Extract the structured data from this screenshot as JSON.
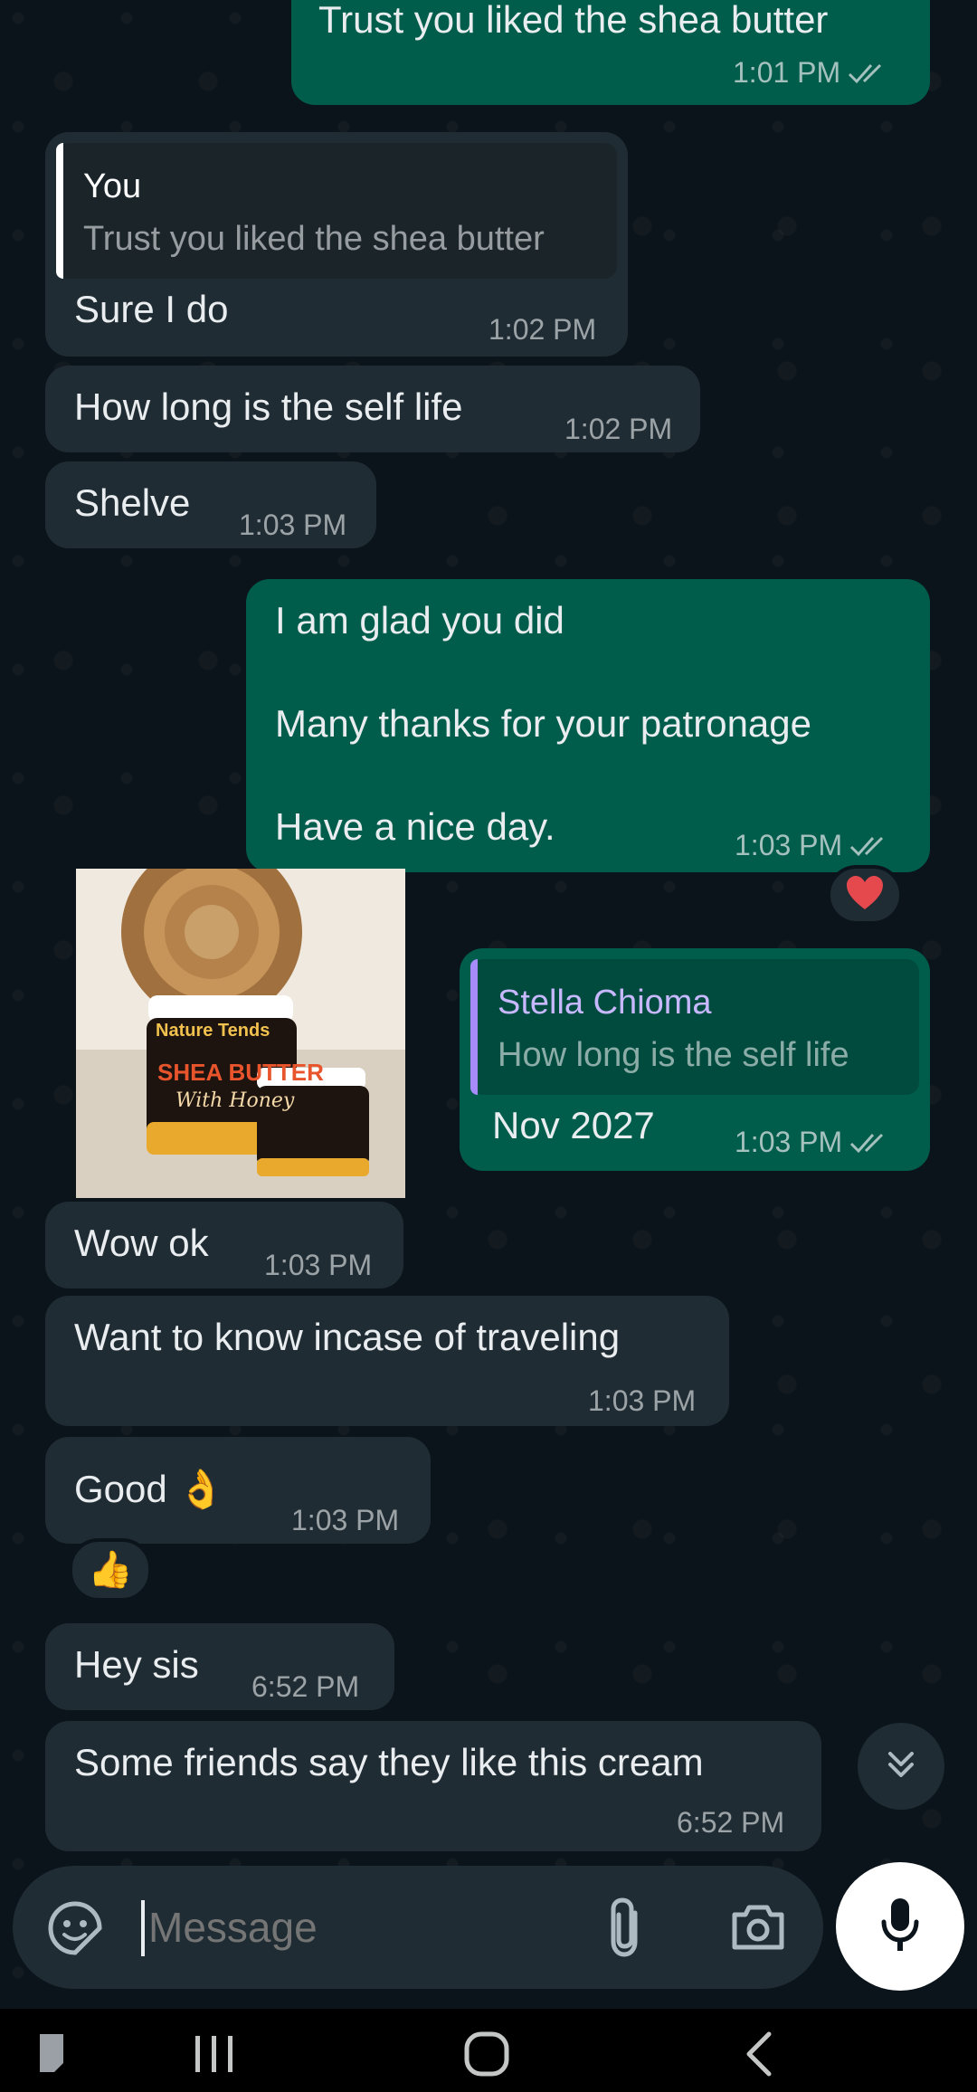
{
  "chat": {
    "messages": [
      {
        "text": "Trust you liked the shea butter",
        "time": "1:01 PM"
      },
      {
        "quote_name": "You",
        "quote_text": "Trust you liked the shea butter",
        "text": "Sure I do",
        "time": "1:02 PM"
      },
      {
        "text": "How long is the self life",
        "time": "1:02 PM"
      },
      {
        "text": "Shelve",
        "time": "1:03 PM"
      },
      {
        "line1": "I am glad you did",
        "line2": "Many thanks for your patronage",
        "line3": "Have a nice day.",
        "time": "1:03 PM",
        "reaction": "❤️"
      },
      {
        "product_label": "Nature Tends",
        "product_title": "SHEA BUTTER",
        "product_subtitle": "With Honey"
      },
      {
        "quote_name": "Stella Chioma",
        "quote_text": "How long is the self life",
        "text": "Nov 2027",
        "time": "1:03 PM"
      },
      {
        "text": "Wow ok",
        "time": "1:03 PM"
      },
      {
        "text": "Want to know incase of traveling",
        "time": "1:03 PM"
      },
      {
        "text": "Good 👌",
        "time": "1:03 PM"
      },
      {
        "emoji": "👍"
      },
      {
        "text": "Hey sis",
        "time": "6:52 PM"
      },
      {
        "text": "Some friends say they like this cream",
        "time": "6:52 PM"
      }
    ]
  },
  "composer": {
    "placeholder": "Message"
  },
  "colors": {
    "background": "#0b141a",
    "incoming_bubble": "#202c33",
    "outgoing_bubble": "#005c4b",
    "quote_you": "#ffffff",
    "quote_stella": "#a78bfa",
    "read_ticks": "#8ab4c7"
  },
  "icons": [
    "check-double-icon",
    "heart-icon",
    "chevrons-down-icon",
    "sticker-icon",
    "attach-icon",
    "camera-icon",
    "mic-icon",
    "recent-apps-icon",
    "home-icon",
    "back-icon",
    "notes-icon"
  ]
}
